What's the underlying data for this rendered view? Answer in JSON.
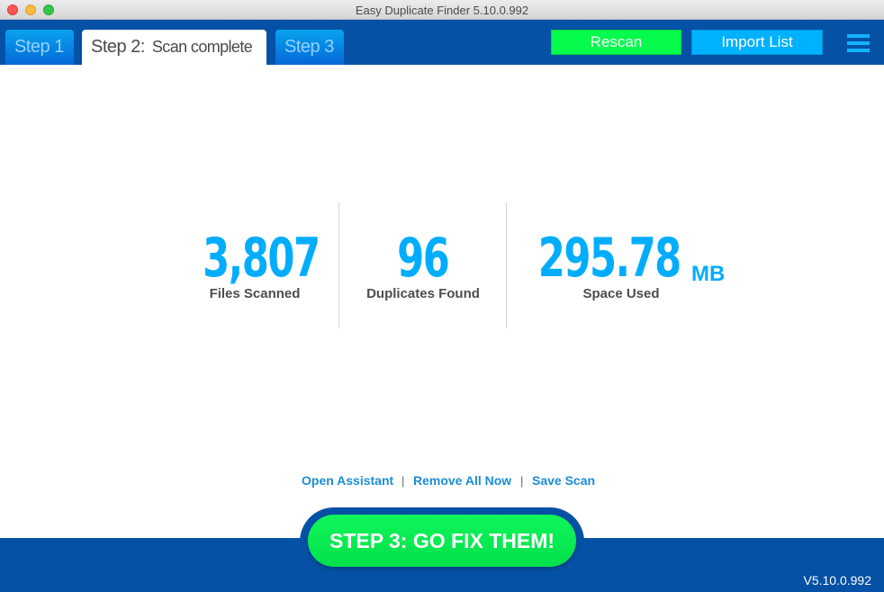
{
  "window": {
    "title": "Easy Duplicate Finder 5.10.0.992"
  },
  "tabs": [
    {
      "label": "Step 1"
    },
    {
      "label": "Step 2:",
      "sublabel": "Scan complete"
    },
    {
      "label": "Step 3"
    }
  ],
  "toolbar": {
    "rescan_label": "Rescan",
    "import_label": "Import List",
    "menu_icon": "hamburger-menu-icon"
  },
  "stats": {
    "files_scanned": {
      "value": "3,807",
      "label": "Files Scanned"
    },
    "duplicates_found": {
      "value": "96",
      "label": "Duplicates Found"
    },
    "space_used": {
      "value": "295.78",
      "unit": "MB",
      "label": "Space Used"
    }
  },
  "links": {
    "open_assistant": "Open Assistant",
    "separator": "|",
    "remove_all_now": "Remove All Now",
    "save_scan": "Save Scan"
  },
  "footer": {
    "go_button_label": "STEP 3: GO FIX THEM!",
    "version": "V5.10.0.992"
  },
  "colors": {
    "header_blue": "#0451a5",
    "accent_cyan": "#00adfc",
    "rescan_green": "#05fc4c",
    "import_blue": "#00b1fd",
    "go_green": "#04e04a",
    "link_blue": "#1c8ed6"
  }
}
